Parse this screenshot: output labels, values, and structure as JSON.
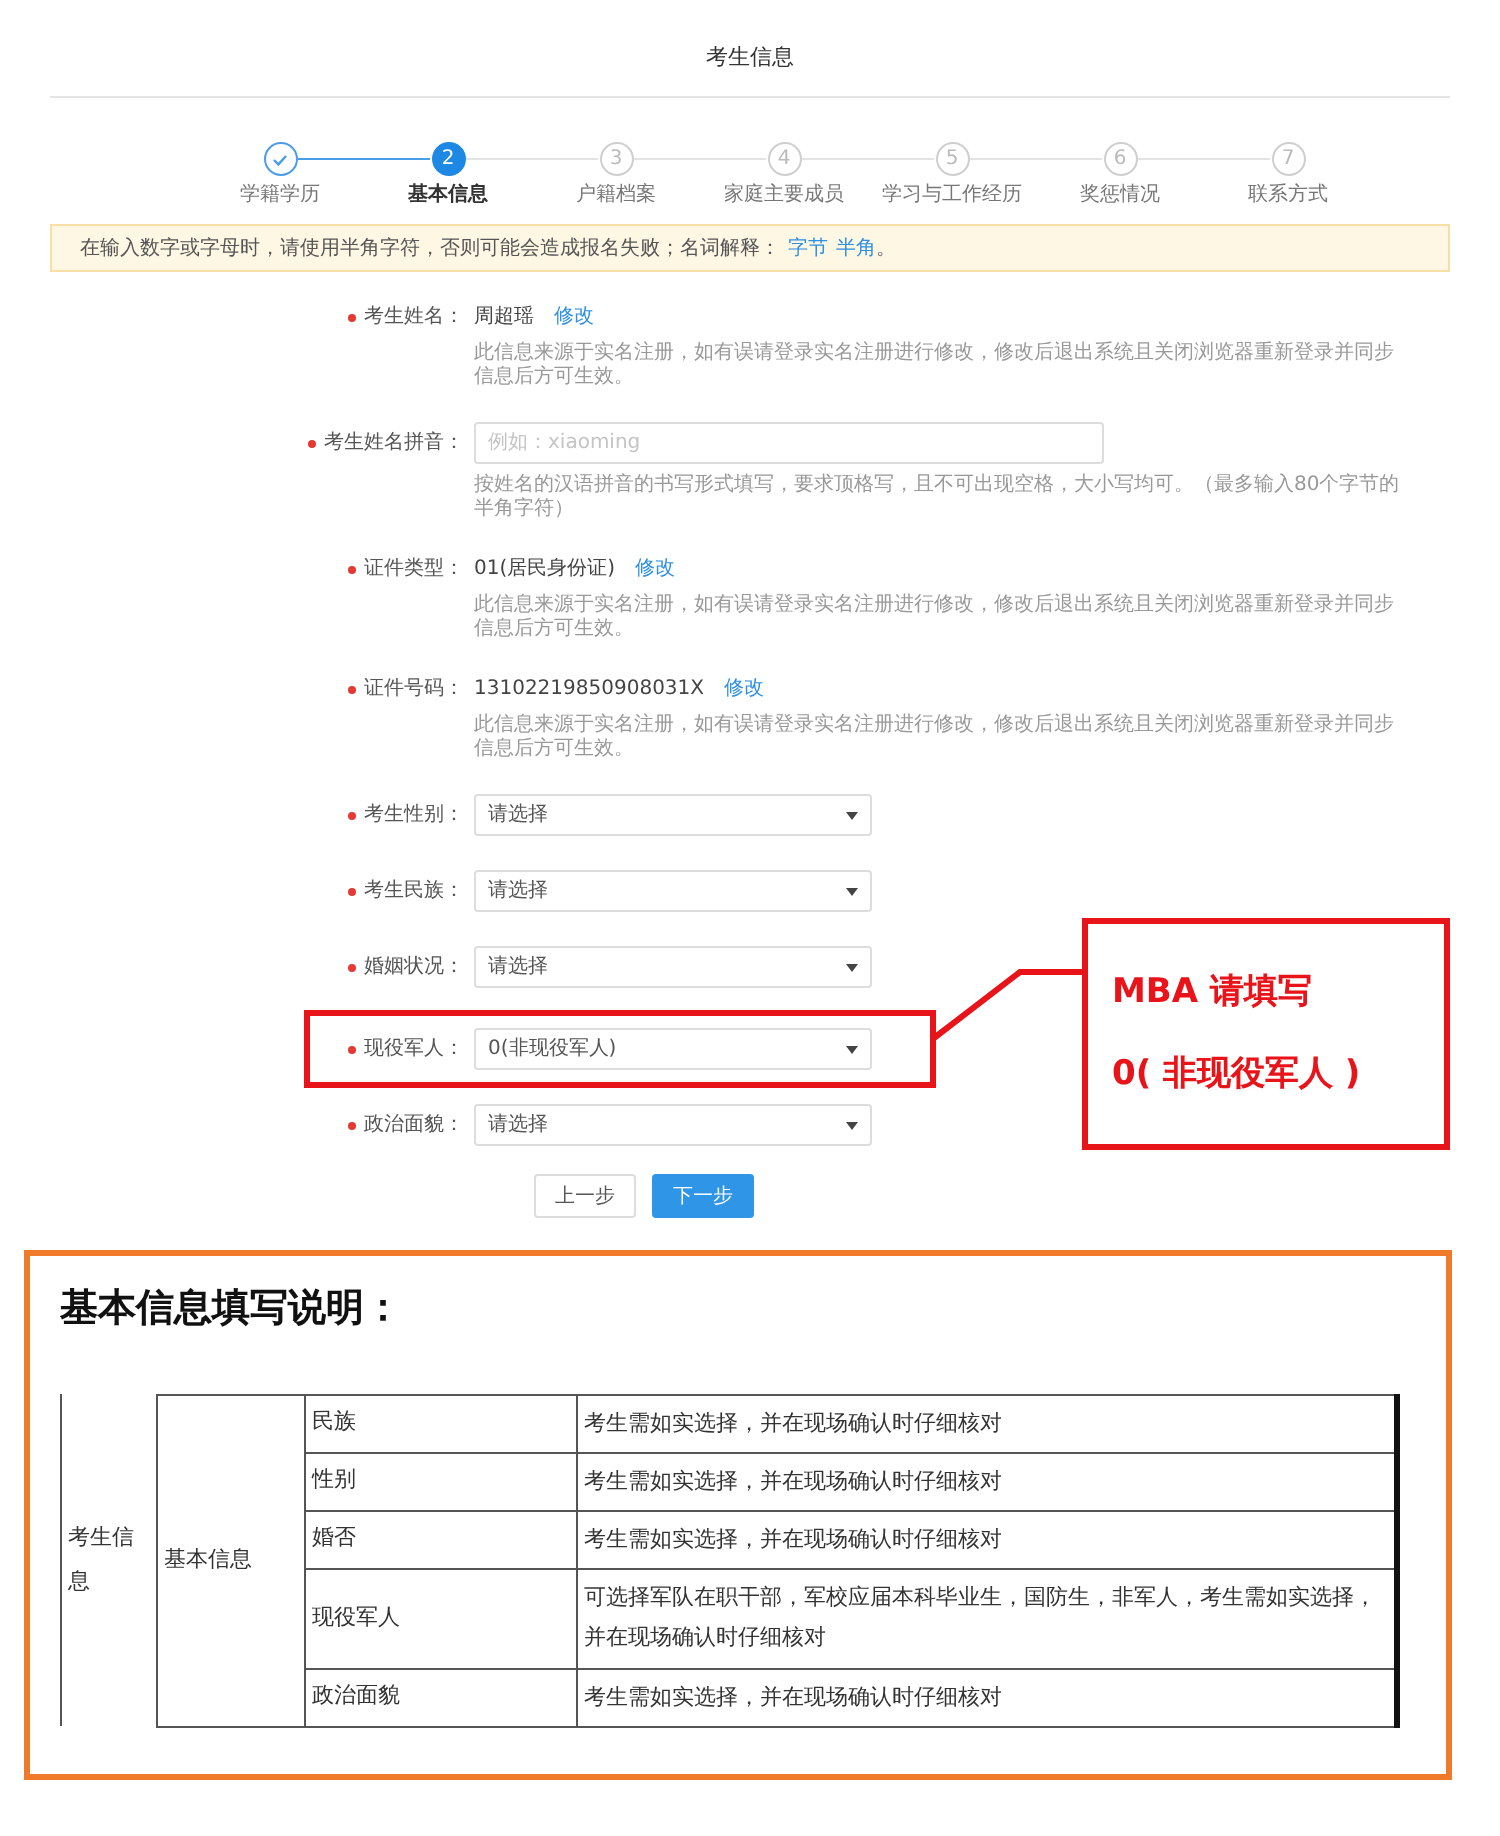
{
  "page_title": "考生信息",
  "steps": [
    {
      "label": "学籍学历",
      "kind": "done"
    },
    {
      "number": "2",
      "label": "基本信息",
      "kind": "current"
    },
    {
      "number": "3",
      "label": "户籍档案",
      "kind": "todo"
    },
    {
      "number": "4",
      "label": "家庭主要成员",
      "kind": "todo"
    },
    {
      "number": "5",
      "label": "学习与工作经历",
      "kind": "todo"
    },
    {
      "number": "6",
      "label": "奖惩情况",
      "kind": "todo"
    },
    {
      "number": "7",
      "label": "联系方式",
      "kind": "todo"
    }
  ],
  "notice": {
    "text": "在输入数字或字母时，请使用半角字符，否则可能会造成报名失败；名词解释：",
    "links": [
      "字节",
      "半角"
    ],
    "end": "。"
  },
  "fields": [
    {
      "kind": "static",
      "label": "考生姓名：",
      "value": "周超瑶",
      "link": "修改",
      "note": "此信息来源于实名注册，如有误请登录实名注册进行修改，修改后退出系统且关闭浏览器重新登录并同步信息后方可生效。"
    },
    {
      "kind": "input",
      "label": "考生姓名拼音：",
      "placeholder": "例如：xiaoming",
      "note": "按姓名的汉语拼音的书写形式填写，要求顶格写，且不可出现空格，大小写均可。（最多输入80个字节的半角字符）"
    },
    {
      "kind": "static",
      "label": "证件类型：",
      "value": "01(居民身份证)",
      "link": "修改",
      "note": "此信息来源于实名注册，如有误请登录实名注册进行修改，修改后退出系统且关闭浏览器重新登录并同步信息后方可生效。"
    },
    {
      "kind": "static",
      "label": "证件号码：",
      "value": "13102219850908031X",
      "link": "修改",
      "note": "此信息来源于实名注册，如有误请登录实名注册进行修改，修改后退出系统且关闭浏览器重新登录并同步信息后方可生效。"
    },
    {
      "kind": "select",
      "label": "考生性别：",
      "value": "请选择",
      "highlighted": false
    },
    {
      "kind": "select",
      "label": "考生民族：",
      "value": "请选择",
      "highlighted": false
    },
    {
      "kind": "select",
      "label": "婚姻状况：",
      "value": "请选择",
      "highlighted": false
    },
    {
      "kind": "select",
      "label": "现役军人：",
      "value": "0(非现役军人)",
      "highlighted": true
    },
    {
      "kind": "select",
      "label": "政治面貌：",
      "value": "请选择",
      "highlighted": false
    }
  ],
  "buttons": [
    {
      "label": "上一步",
      "primary": false
    },
    {
      "label": "下一步",
      "primary": true
    }
  ],
  "callout": [
    "MBA 请填写",
    "0( 非现役军人 )"
  ],
  "explanation": {
    "title": "基本信息填写说明：",
    "group": "考生信息",
    "subgroup": "基本信息",
    "rows": [
      {
        "item": "民族",
        "description": "考生需如实选择，并在现场确认时仔细核对"
      },
      {
        "item": "性别",
        "description": "考生需如实选择，并在现场确认时仔细核对"
      },
      {
        "item": "婚否",
        "description": "考生需如实选择，并在现场确认时仔细核对"
      },
      {
        "item": "现役军人",
        "description": "可选择军队在职干部，军校应届本科毕业生，国防生，非军人，考生需如实选择，并在现场确认时仔细核对"
      },
      {
        "item": "政治面貌",
        "description": "考生需如实选择，并在现场确认时仔细核对"
      }
    ]
  }
}
